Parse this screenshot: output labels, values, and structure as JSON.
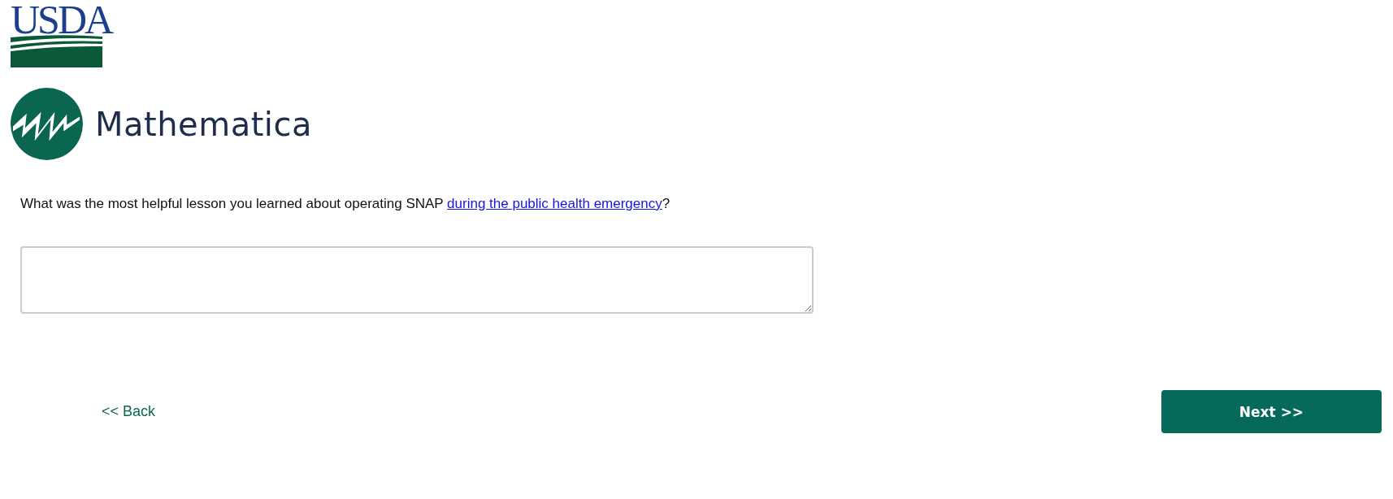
{
  "logos": [
    {
      "kind": "usda",
      "text": "USDA"
    },
    {
      "kind": "mathematica",
      "text": "Mathematica"
    }
  ],
  "question": {
    "text": "What was the most helpful lesson you learned about operating SNAP ",
    "link": "during the public health emergency",
    "text_after": "?"
  },
  "navigation": {
    "back": "<< Back",
    "next": "Next >>"
  }
}
